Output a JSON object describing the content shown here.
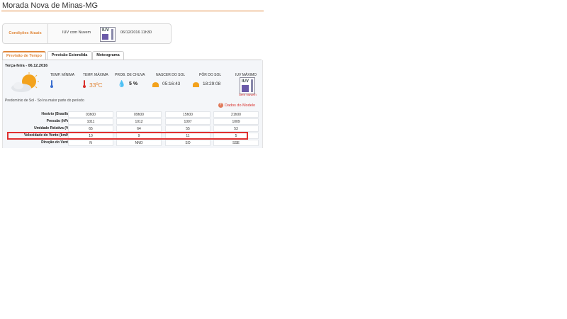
{
  "header": {
    "city": "Morada Nova de Minas-MG"
  },
  "conditions": {
    "label": "Condições Atuais",
    "description": "IUV com Nuvem",
    "date": "06/12/2016 11h30",
    "uv_text": "IUV"
  },
  "tabs": [
    {
      "label": "Previsão de Tempo"
    },
    {
      "label": "Previsão Estendida"
    },
    {
      "label": "Meteograma"
    }
  ],
  "forecast": {
    "day": "Terça-feira - 06.12.2016",
    "headers": {
      "tmin": "TEMP. MÍNIMA",
      "tmax": "TEMP. MÁXIMA",
      "rain": "PROB. DE CHUVA",
      "sunrise": "NASCER DO SOL",
      "sunset": "PÔR DO SOL",
      "uv": "IUV MÁXIMO"
    },
    "tmax_value": "33ºC",
    "rain_value": "5 %",
    "sunrise_value": "05:16:43",
    "sunset_value": "18:29:08",
    "uv_text": "IUV",
    "uv_label": "Sem Nuvem",
    "summary": "Predomínio de Sol - Sol na maior parte do período",
    "model_link": "Dados do Modelo",
    "rows": [
      {
        "label": "Horário (Brasília)",
        "values": [
          "03h00",
          "09h00",
          "15h00",
          "21h00"
        ]
      },
      {
        "label": "Pressão (hPa)",
        "values": [
          "1011",
          "1012",
          "1007",
          "1009"
        ]
      },
      {
        "label": "Umidade Relativa (%)",
        "values": [
          "65",
          "64",
          "55",
          "53"
        ]
      },
      {
        "label": "Velocidade do Vento (km/h)",
        "values": [
          "10",
          "9",
          "11",
          "5"
        ]
      },
      {
        "label": "Direção do Vento",
        "values": [
          "N",
          "NNO",
          "SO",
          "SSE"
        ]
      }
    ]
  },
  "colors": {
    "accent": "#e0873a",
    "link": "#d9302c",
    "highlight": "#e03030"
  }
}
